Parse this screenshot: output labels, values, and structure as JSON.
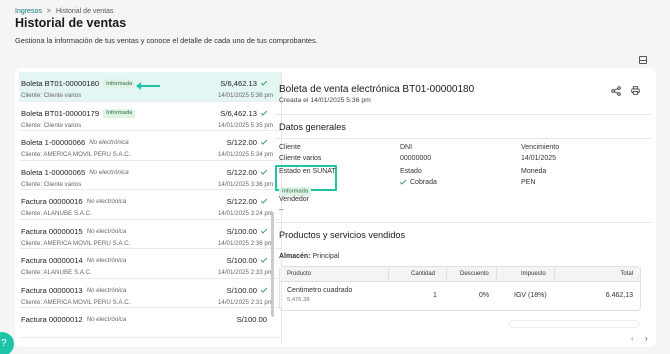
{
  "breadcrumb": {
    "parent": "Ingresos",
    "separator": ">",
    "current": "Historial de ventas"
  },
  "page": {
    "title": "Historial de ventas",
    "subtitle": "Gestiona la información de tus ventas y conoce el detalle de cada uno de tus comprobantes."
  },
  "list": [
    {
      "doc": "Boleta BT01-00000180",
      "tag": "Informada",
      "tag_type": "badge",
      "client": "Cliente: Cliente varios",
      "amount": "S/6,462.13",
      "date": "14/01/2025 5:36 pm"
    },
    {
      "doc": "Boleta BT01-00000179",
      "tag": "Informada",
      "tag_type": "badge",
      "client": "Cliente: Cliente varios",
      "amount": "S/6,462.13",
      "date": "14/01/2025 5:35 pm"
    },
    {
      "doc": "Boleta 1-00000066",
      "tag": "No electrónica",
      "tag_type": "italic",
      "client": "Cliente: AMERICA MOVIL PERU S.A.C.",
      "amount": "S/122.00",
      "date": "14/01/2025 5:34 pm"
    },
    {
      "doc": "Boleta 1-00000065",
      "tag": "No electrónica",
      "tag_type": "italic",
      "client": "Cliente: Cliente varios",
      "amount": "S/122.00",
      "date": "14/01/2025 3:36 pm"
    },
    {
      "doc": "Factura 00000016",
      "tag": "No electrónica",
      "tag_type": "italic",
      "client": "Cliente: ALANUBE S.A.C.",
      "amount": "S/122.00",
      "date": "14/01/2025 3:24 pm"
    },
    {
      "doc": "Factura 00000015",
      "tag": "No electrónica",
      "tag_type": "italic",
      "client": "Cliente: AMERICA MOVIL PERU S.A.C.",
      "amount": "S/100.00",
      "date": "14/01/2025 2:36 pm"
    },
    {
      "doc": "Factura 00000014",
      "tag": "No electrónica",
      "tag_type": "italic",
      "client": "Cliente: ALANUBE S.A.C.",
      "amount": "S/100.00",
      "date": "14/01/2025 2:33 pm"
    },
    {
      "doc": "Factura 00000013",
      "tag": "No electrónica",
      "tag_type": "italic",
      "client": "Cliente: AMERICA MOVIL PERU S.A.C.",
      "amount": "S/100.00",
      "date": "14/01/2025 2:31 pm"
    },
    {
      "doc": "Factura 00000012",
      "tag": "No electrónica",
      "tag_type": "italic",
      "client": "",
      "amount": "S/100.00",
      "date": ""
    }
  ],
  "detail": {
    "title": "Boleta de venta electrónica BT01-00000180",
    "created": "Creada el 14/01/2025 5:36 pm",
    "section_general": "Datos generales",
    "fields": {
      "cliente_label": "Cliente",
      "cliente_value": "Cliente varios",
      "dni_label": "DNI",
      "dni_value": "00000000",
      "venc_label": "Vencimiento",
      "venc_value": "14/01/2025",
      "sunat_label": "Estado en SUNAT",
      "sunat_value": "Informada",
      "estado_label": "Estado",
      "estado_value": "Cobrada",
      "moneda_label": "Moneda",
      "moneda_value": "PEN",
      "vendedor_label": "Vendedor",
      "vendedor_value": "--"
    },
    "section_products": "Productos y servicios vendidos",
    "almacen_label": "Almacén:",
    "almacen_value": "Principal",
    "table": {
      "headers": [
        "Producto",
        "Cantidad",
        "Descuento",
        "Impuesto",
        "Total"
      ],
      "row": {
        "producto": "Centimetro cuadrado",
        "sub": "5,476.38",
        "cantidad": "1",
        "descuento": "0%",
        "impuesto": "IGV (18%)",
        "total": "6.462,13"
      }
    }
  },
  "pager": {
    "prev": "‹",
    "next": "›"
  },
  "colors": {
    "accent": "#1ec3a8",
    "active_row": "#e3f6f4",
    "badge_bg": "#dff3e5"
  }
}
